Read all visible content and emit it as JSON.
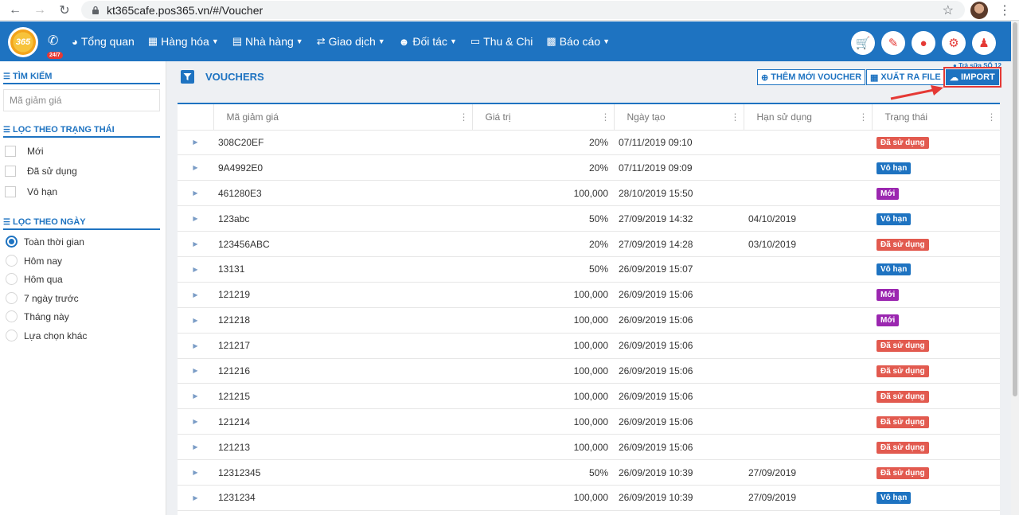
{
  "browser": {
    "url": "kt365cafe.pos365.vn/#/Voucher"
  },
  "header": {
    "logo_text": "365",
    "hotline_badge": "24/7",
    "menu": [
      {
        "label": "Tổng quan",
        "icon": "dashboard-icon",
        "dropdown": false
      },
      {
        "label": "Hàng hóa",
        "icon": "cubes-icon",
        "dropdown": true
      },
      {
        "label": "Nhà hàng",
        "icon": "bed-icon",
        "dropdown": true
      },
      {
        "label": "Giao dịch",
        "icon": "exchange-icon",
        "dropdown": true
      },
      {
        "label": "Đối tác",
        "icon": "users-icon",
        "dropdown": true
      },
      {
        "label": "Thu & Chi",
        "icon": "money-icon",
        "dropdown": false
      },
      {
        "label": "Báo cáo",
        "icon": "bar-chart-icon",
        "dropdown": true
      }
    ],
    "actions": [
      "cart-icon",
      "edit-icon",
      "map-marker-icon",
      "gear-icon",
      "user-icon"
    ]
  },
  "sidebar": {
    "search_title": "TÌM KIẾM",
    "search_placeholder": "Mã giảm giá",
    "status_title": "LỌC THEO TRẠNG THÁI",
    "status_options": [
      "Mới",
      "Đã sử dụng",
      "Vô hạn"
    ],
    "date_title": "LỌC THEO NGÀY",
    "date_options": [
      "Toàn thời gian",
      "Hôm nay",
      "Hôm qua",
      "7 ngày trước",
      "Tháng này",
      "Lựa chọn khác"
    ],
    "date_selected": "Toàn thời gian"
  },
  "main": {
    "title": "VOUCHERS",
    "store_label": "Trà sữa SỐ 12",
    "buttons": {
      "add": "THÊM MỚI VOUCHER",
      "export": "XUẤT RA FILE",
      "import": "IMPORT"
    },
    "columns": [
      "Mã giảm giá",
      "Giá trị",
      "Ngày tạo",
      "Hạn sử dụng",
      "Trạng thái"
    ],
    "rows": [
      {
        "code": "308C20EF",
        "value": "20%",
        "created": "07/11/2019 09:10",
        "expiry": "",
        "status": "Đã sử dụng",
        "status_type": "used"
      },
      {
        "code": "9A4992E0",
        "value": "20%",
        "created": "07/11/2019 09:09",
        "expiry": "",
        "status": "Vô hạn",
        "status_type": "unlimited"
      },
      {
        "code": "461280E3",
        "value": "100,000",
        "created": "28/10/2019 15:50",
        "expiry": "",
        "status": "Mới",
        "status_type": "new"
      },
      {
        "code": "123abc",
        "value": "50%",
        "created": "27/09/2019 14:32",
        "expiry": "04/10/2019",
        "status": "Vô hạn",
        "status_type": "unlimited"
      },
      {
        "code": "123456ABC",
        "value": "20%",
        "created": "27/09/2019 14:28",
        "expiry": "03/10/2019",
        "status": "Đã sử dụng",
        "status_type": "used"
      },
      {
        "code": "13131",
        "value": "50%",
        "created": "26/09/2019 15:07",
        "expiry": "",
        "status": "Vô hạn",
        "status_type": "unlimited"
      },
      {
        "code": "121219",
        "value": "100,000",
        "created": "26/09/2019 15:06",
        "expiry": "",
        "status": "Mới",
        "status_type": "new"
      },
      {
        "code": "121218",
        "value": "100,000",
        "created": "26/09/2019 15:06",
        "expiry": "",
        "status": "Mới",
        "status_type": "new"
      },
      {
        "code": "121217",
        "value": "100,000",
        "created": "26/09/2019 15:06",
        "expiry": "",
        "status": "Đã sử dụng",
        "status_type": "used"
      },
      {
        "code": "121216",
        "value": "100,000",
        "created": "26/09/2019 15:06",
        "expiry": "",
        "status": "Đã sử dụng",
        "status_type": "used"
      },
      {
        "code": "121215",
        "value": "100,000",
        "created": "26/09/2019 15:06",
        "expiry": "",
        "status": "Đã sử dụng",
        "status_type": "used"
      },
      {
        "code": "121214",
        "value": "100,000",
        "created": "26/09/2019 15:06",
        "expiry": "",
        "status": "Đã sử dụng",
        "status_type": "used"
      },
      {
        "code": "121213",
        "value": "100,000",
        "created": "26/09/2019 15:06",
        "expiry": "",
        "status": "Đã sử dụng",
        "status_type": "used"
      },
      {
        "code": "12312345",
        "value": "50%",
        "created": "26/09/2019 10:39",
        "expiry": "27/09/2019",
        "status": "Đã sử dụng",
        "status_type": "used"
      },
      {
        "code": "1231234",
        "value": "100,000",
        "created": "26/09/2019 10:39",
        "expiry": "27/09/2019",
        "status": "Vô hạn",
        "status_type": "unlimited"
      }
    ]
  },
  "colors": {
    "brand": "#1e73c1",
    "used": "#e25a4f",
    "unlimited": "#1e73c1",
    "new": "#9b27b0",
    "highlight": "#e53935"
  }
}
